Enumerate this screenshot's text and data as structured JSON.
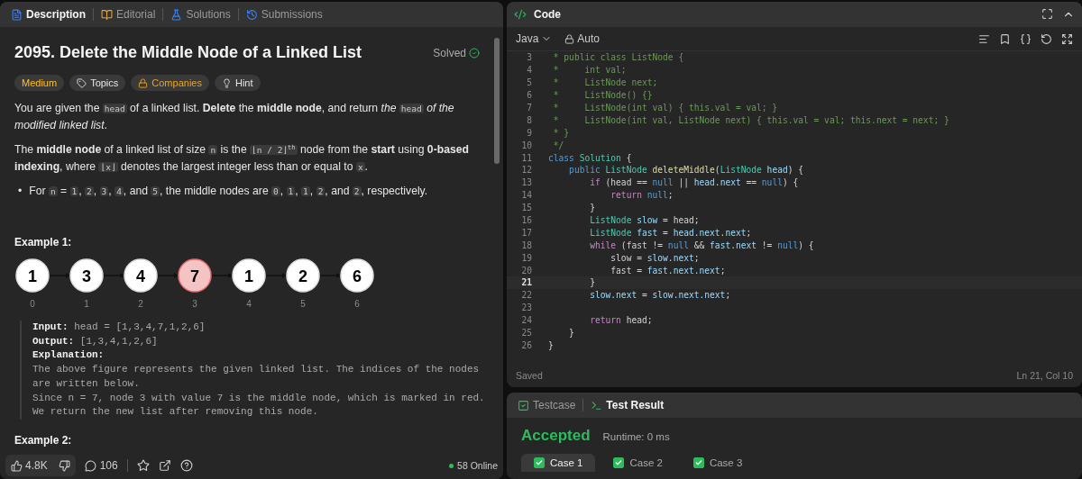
{
  "description_panel": {
    "tabs": [
      {
        "label": "Description",
        "selected": true
      },
      {
        "label": "Editorial",
        "selected": false
      },
      {
        "label": "Solutions",
        "selected": false
      },
      {
        "label": "Submissions",
        "selected": false
      }
    ],
    "title": "2095. Delete the Middle Node of a Linked List",
    "status": "Solved",
    "tags": [
      {
        "label": "Medium",
        "kind": "difficulty"
      },
      {
        "label": "Topics",
        "kind": "tag"
      },
      {
        "label": "Companies",
        "kind": "lock"
      },
      {
        "label": "Hint",
        "kind": "bulb"
      }
    ],
    "paragraphs": [
      [
        {
          "kind": "text",
          "text": "You are given the "
        },
        {
          "kind": "code",
          "text": "head"
        },
        {
          "kind": "text",
          "text": " of a linked list. **Delete** the **middle node**, and return *the* "
        },
        {
          "kind": "code",
          "text": "head"
        },
        {
          "kind": "text",
          "text": " *of the modified linked list*."
        }
      ],
      [
        {
          "kind": "text",
          "text": "The **middle node** of a linked list of size "
        },
        {
          "kind": "code",
          "text": "n"
        },
        {
          "kind": "text",
          "text": " is the "
        },
        {
          "kind": "code",
          "text": "⌊n / 2⌋$^{th}$"
        },
        {
          "kind": "text",
          "text": " node from the **start** using **0-based indexing**, where "
        },
        {
          "kind": "code",
          "text": "⌊x⌋"
        },
        {
          "kind": "text",
          "text": " denotes the largest integer less than or equal to "
        },
        {
          "kind": "code",
          "text": "x"
        },
        {
          "kind": "text",
          "text": "."
        }
      ]
    ],
    "bullets": [
      {
        "marker": "•",
        "segments": [
          {
            "kind": "text",
            "text": "For "
          },
          {
            "kind": "code",
            "text": "n"
          },
          {
            "kind": "text",
            "text": " = "
          },
          {
            "kind": "code",
            "text": "1"
          },
          {
            "kind": "text",
            "text": ", "
          },
          {
            "kind": "code",
            "text": "2"
          },
          {
            "kind": "text",
            "text": ", "
          },
          {
            "kind": "code",
            "text": "3"
          },
          {
            "kind": "text",
            "text": ", "
          },
          {
            "kind": "code",
            "text": "4"
          },
          {
            "kind": "text",
            "text": ", and "
          },
          {
            "kind": "code",
            "text": "5"
          },
          {
            "kind": "text",
            "text": ", the middle nodes are "
          },
          {
            "kind": "code",
            "text": "0"
          },
          {
            "kind": "text",
            "text": ", "
          },
          {
            "kind": "code",
            "text": "1"
          },
          {
            "kind": "text",
            "text": ", "
          },
          {
            "kind": "code",
            "text": "1"
          },
          {
            "kind": "text",
            "text": ", "
          },
          {
            "kind": "code",
            "text": "2"
          },
          {
            "kind": "text",
            "text": ", and "
          },
          {
            "kind": "code",
            "text": "2"
          },
          {
            "kind": "text",
            "text": ", respectively."
          }
        ]
      }
    ],
    "example": {
      "heading": "Example 1:",
      "nodes": [
        {
          "value": "1",
          "index": "0",
          "highlighted": false
        },
        {
          "value": "3",
          "index": "1",
          "highlighted": false
        },
        {
          "value": "4",
          "index": "2",
          "highlighted": false
        },
        {
          "value": "7",
          "index": "3",
          "highlighted": true
        },
        {
          "value": "1",
          "index": "4",
          "highlighted": false
        },
        {
          "value": "2",
          "index": "5",
          "highlighted": false
        },
        {
          "value": "6",
          "index": "6",
          "highlighted": false
        }
      ],
      "lines": [
        {
          "label": "Input:",
          "text": " head = [1,3,4,7,1,2,6]"
        },
        {
          "label": "Output:",
          "text": " [1,3,4,1,2,6]"
        },
        {
          "label": "Explanation:"
        },
        {
          "text": "The above figure represents the given linked list. The indices of the nodes"
        },
        {
          "text": "are written below."
        },
        {
          "text": "Since n = 7, node 3 with value 7 is the middle node, which is marked in red."
        },
        {
          "text": "We return the new list after removing this node."
        }
      ]
    },
    "next_heading": "Example 2:",
    "footer": {
      "likes": "4.8K",
      "comments": "106",
      "online": "58 Online"
    }
  },
  "code_panel": {
    "title": "Code",
    "language": "Java",
    "mode": "Auto",
    "lines": [
      {
        "number": "3",
        "current": false,
        "tokens": [
          {
            "kind": "comment",
            "text": " * public class ListNode {"
          }
        ]
      },
      {
        "number": "4",
        "current": false,
        "tokens": [
          {
            "kind": "comment",
            "text": " *     int val;"
          }
        ]
      },
      {
        "number": "5",
        "current": false,
        "tokens": [
          {
            "kind": "comment",
            "text": " *     ListNode next;"
          }
        ]
      },
      {
        "number": "6",
        "current": false,
        "tokens": [
          {
            "kind": "comment",
            "text": " *     ListNode() {}"
          }
        ]
      },
      {
        "number": "7",
        "current": false,
        "tokens": [
          {
            "kind": "comment",
            "text": " *     ListNode(int val) { this.val = val; }"
          }
        ]
      },
      {
        "number": "8",
        "current": false,
        "tokens": [
          {
            "kind": "comment",
            "text": " *     ListNode(int val, ListNode next) { this.val = val; this.next = next; }"
          }
        ]
      },
      {
        "number": "9",
        "current": false,
        "tokens": [
          {
            "kind": "comment",
            "text": " * }"
          }
        ]
      },
      {
        "number": "10",
        "current": false,
        "tokens": [
          {
            "kind": "comment",
            "text": " */"
          }
        ]
      },
      {
        "number": "11",
        "current": false,
        "tokens": [
          {
            "kind": "keyword",
            "text": "class "
          },
          {
            "kind": "type",
            "text": "Solution"
          },
          {
            "kind": "plain",
            "text": " {"
          }
        ]
      },
      {
        "number": "12",
        "current": false,
        "tokens": [
          {
            "kind": "keyword",
            "text": "    public "
          },
          {
            "kind": "type",
            "text": "ListNode "
          },
          {
            "kind": "function",
            "text": "deleteMiddle"
          },
          {
            "kind": "plain",
            "text": "("
          },
          {
            "kind": "type",
            "text": "ListNode "
          },
          {
            "kind": "variable",
            "text": "head"
          },
          {
            "kind": "plain",
            "text": ") {"
          }
        ]
      },
      {
        "number": "13",
        "current": false,
        "tokens": [
          {
            "kind": "control",
            "text": "        if"
          },
          {
            "kind": "plain",
            "text": " (head == "
          },
          {
            "kind": "keyword",
            "text": "null"
          },
          {
            "kind": "plain",
            "text": " || "
          },
          {
            "kind": "variable",
            "text": "head.next"
          },
          {
            "kind": "plain",
            "text": " == "
          },
          {
            "kind": "keyword",
            "text": "null"
          },
          {
            "kind": "plain",
            "text": ") {"
          }
        ]
      },
      {
        "number": "14",
        "current": false,
        "tokens": [
          {
            "kind": "control",
            "text": "            return "
          },
          {
            "kind": "keyword",
            "text": "null"
          },
          {
            "kind": "plain",
            "text": ";"
          }
        ]
      },
      {
        "number": "15",
        "current": false,
        "tokens": [
          {
            "kind": "plain",
            "text": "        }"
          }
        ]
      },
      {
        "number": "16",
        "current": false,
        "tokens": [
          {
            "kind": "type",
            "text": "        ListNode "
          },
          {
            "kind": "variable",
            "text": "slow"
          },
          {
            "kind": "plain",
            "text": " = head;"
          }
        ]
      },
      {
        "number": "17",
        "current": false,
        "tokens": [
          {
            "kind": "type",
            "text": "        ListNode "
          },
          {
            "kind": "variable",
            "text": "fast"
          },
          {
            "kind": "plain",
            "text": " = "
          },
          {
            "kind": "variable",
            "text": "head.next.next"
          },
          {
            "kind": "plain",
            "text": ";"
          }
        ]
      },
      {
        "number": "18",
        "current": false,
        "tokens": [
          {
            "kind": "control",
            "text": "        while"
          },
          {
            "kind": "plain",
            "text": " (fast != "
          },
          {
            "kind": "keyword",
            "text": "null"
          },
          {
            "kind": "plain",
            "text": " && "
          },
          {
            "kind": "variable",
            "text": "fast.next"
          },
          {
            "kind": "plain",
            "text": " != "
          },
          {
            "kind": "keyword",
            "text": "null"
          },
          {
            "kind": "plain",
            "text": ") {"
          }
        ]
      },
      {
        "number": "19",
        "current": false,
        "tokens": [
          {
            "kind": "plain",
            "text": "            slow = "
          },
          {
            "kind": "variable",
            "text": "slow.next"
          },
          {
            "kind": "plain",
            "text": ";"
          }
        ]
      },
      {
        "number": "20",
        "current": false,
        "tokens": [
          {
            "kind": "plain",
            "text": "            fast = "
          },
          {
            "kind": "variable",
            "text": "fast.next.next"
          },
          {
            "kind": "plain",
            "text": ";"
          }
        ]
      },
      {
        "number": "21",
        "current": true,
        "tokens": [
          {
            "kind": "plain",
            "text": "        }"
          }
        ]
      },
      {
        "number": "22",
        "current": false,
        "tokens": [
          {
            "kind": "variable",
            "text": "        slow.next"
          },
          {
            "kind": "plain",
            "text": " = "
          },
          {
            "kind": "variable",
            "text": "slow.next.next"
          },
          {
            "kind": "plain",
            "text": ";"
          }
        ]
      },
      {
        "number": "23",
        "current": false
      },
      {
        "number": "24",
        "current": false,
        "tokens": [
          {
            "kind": "control",
            "text": "        return"
          },
          {
            "kind": "plain",
            "text": " head;"
          }
        ]
      },
      {
        "number": "25",
        "current": false,
        "tokens": [
          {
            "kind": "plain",
            "text": "    }"
          }
        ]
      },
      {
        "number": "26",
        "current": false,
        "tokens": [
          {
            "kind": "plain",
            "text": "}"
          }
        ]
      }
    ],
    "save_status": "Saved",
    "cursor": "Ln 21, Col 10"
  },
  "result_panel": {
    "tabs": [
      {
        "label": "Testcase",
        "selected": false
      },
      {
        "label": "Test Result",
        "selected": true
      }
    ],
    "verdict": "Accepted",
    "runtime": "Runtime: 0 ms",
    "cases": [
      {
        "label": "Case 1",
        "checked": true,
        "selected": true
      },
      {
        "label": "Case 2",
        "checked": true,
        "selected": false
      },
      {
        "label": "Case 3",
        "checked": true,
        "selected": false
      }
    ]
  }
}
